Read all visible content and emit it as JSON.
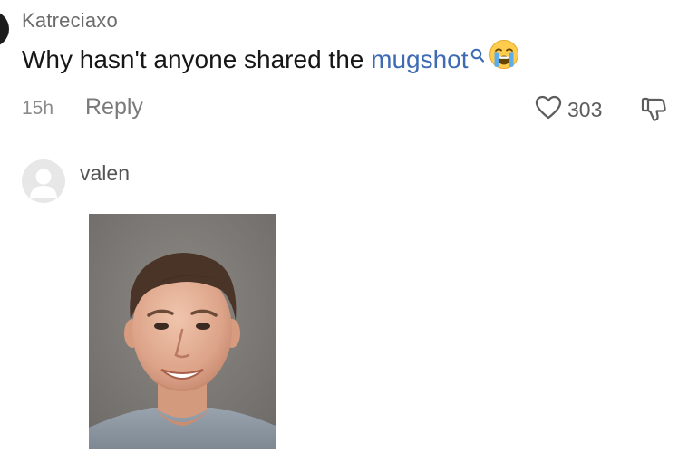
{
  "comment": {
    "username": "Katreciaxo",
    "text_before_link": "Why hasn't anyone shared the ",
    "link_text": "mugshot",
    "emoji": "loudly-crying-face",
    "timestamp": "15h",
    "reply_label": "Reply",
    "like_count": "303"
  },
  "reply": {
    "username": "valen",
    "attachment": "photo"
  },
  "colors": {
    "link": "#3f6bb5",
    "username": "#6c6c6c",
    "meta": "#8a8a8a"
  }
}
